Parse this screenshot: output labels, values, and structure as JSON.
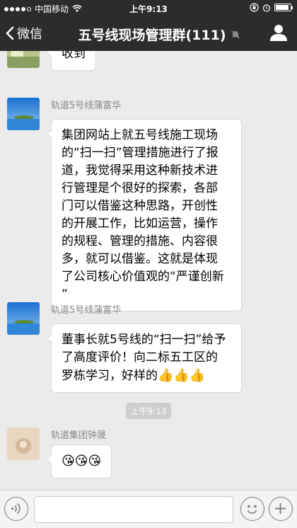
{
  "status_bar": {
    "carrier": "中国移动",
    "time": "上午9:13",
    "battery_level": 0.9
  },
  "nav": {
    "back_label": "微信",
    "title": "五号线现场管理群(111)"
  },
  "messages": [
    {
      "sender": "",
      "text": "收到"
    },
    {
      "sender": "轨道5号线蒲富华",
      "lines": [
        "集团网站上就五号线施工现场",
        "的“扫一扫”管理措施进行了报",
        "道，我觉得采用这种新技术进",
        "行管理是个很好的探索，各部",
        "门可以借鉴这种思路，开创性",
        "的开展工作，比如运营，操作",
        "的规程、管理的措施、内容很",
        "多，就可以借鉴。这就是体现",
        "了公司核心价值观的“严谨创新",
        "”"
      ]
    },
    {
      "sender": "轨道5号线蒲富华",
      "lines": [
        "董事长就5号线的“扫一扫”给予",
        "了高度评价！向二标五工区的",
        "罗栋学习，好样的"
      ],
      "emoji": "👍👍👍"
    },
    {
      "sender": "轨道集团钟晟",
      "emoji": "😘😘😘"
    }
  ],
  "time_divider": "上午9:13",
  "input": {
    "value": "",
    "placeholder": ""
  },
  "colors": {
    "nav_bg": "#2c2c2e",
    "chat_bg": "#ebebeb",
    "bubble_bg": "#ffffff"
  }
}
